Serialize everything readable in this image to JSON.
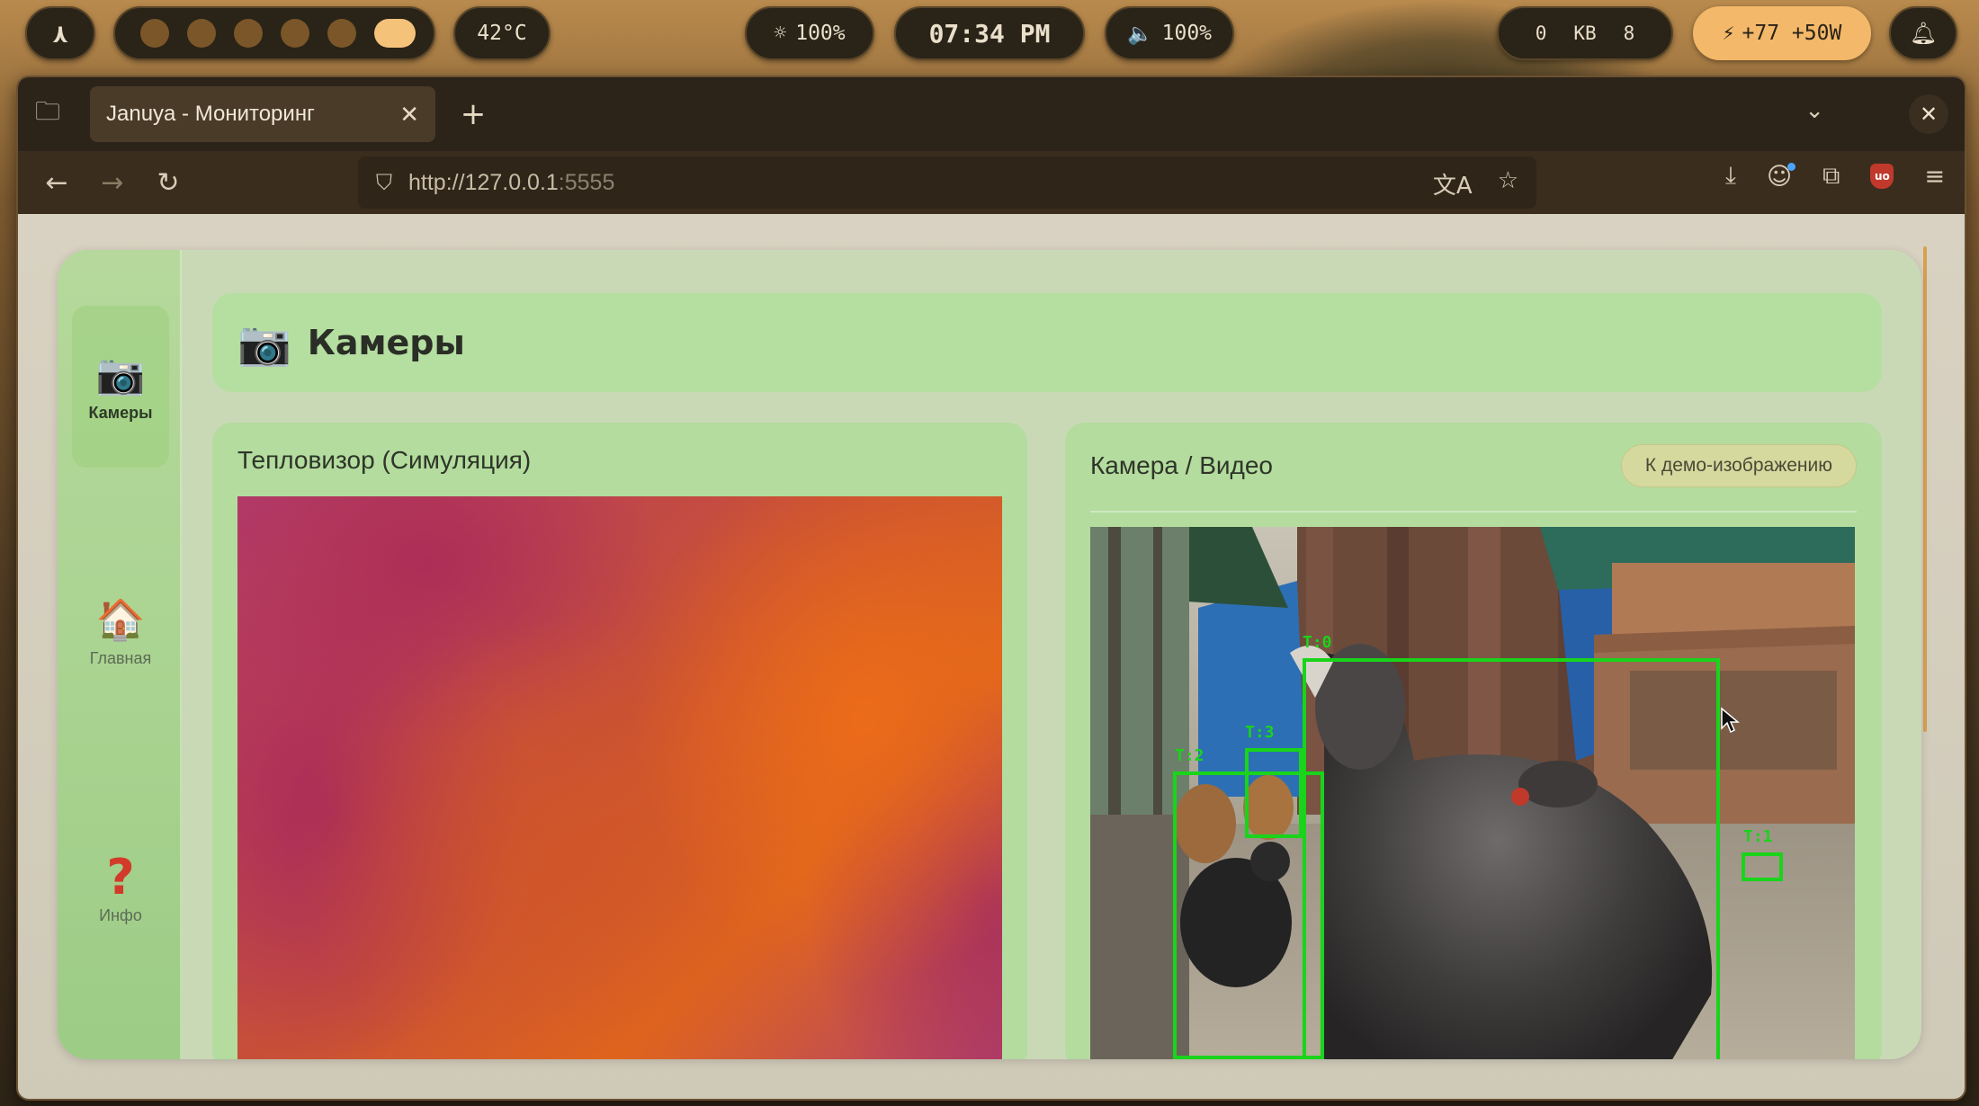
{
  "system_bar": {
    "launcher_icon": "launcher-icon",
    "temperature": "42°C",
    "brightness": "100%",
    "brightness_icon": "sun-icon",
    "clock": "07:34 PM",
    "volume": "100%",
    "volume_icon": "speaker-icon",
    "network": {
      "down": "0",
      "unit": "KB",
      "up": "8"
    },
    "power": "+77 +50W",
    "power_icon": "bolt-icon",
    "notifications_icon": "bell-icon",
    "workspaces_count": 6,
    "active_workspace": 6
  },
  "browser": {
    "tab_title": "Januya - Мониторинг",
    "url_host": "http://127.0.0.1",
    "url_port": ":5555"
  },
  "sidebar": {
    "items": [
      {
        "label": "Камеры",
        "icon": "camera-icon",
        "active": true
      },
      {
        "label": "Главная",
        "icon": "house-icon",
        "active": false
      },
      {
        "label": "Инфо",
        "icon": "question-icon",
        "active": false
      }
    ]
  },
  "page": {
    "title": "Камеры",
    "title_icon": "camera-icon"
  },
  "thermal_panel": {
    "title": "Тепловизор (Симуляция)"
  },
  "video_panel": {
    "title": "Камера / Видео",
    "demo_button": "К демо-изображению",
    "detections": [
      {
        "label": "T:0"
      },
      {
        "label": "T:1"
      },
      {
        "label": "T:2"
      },
      {
        "label": "T:3"
      }
    ]
  },
  "colors": {
    "accent_green": "#19d41a",
    "panel_green": "#b3dc9e",
    "power_pill": "#f3b869"
  }
}
